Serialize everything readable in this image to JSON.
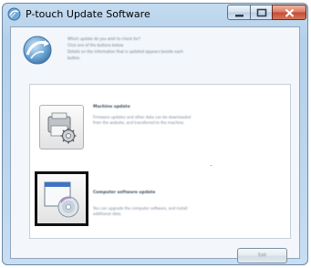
{
  "window": {
    "title": "P-touch Update Software",
    "controls": [
      "minimize",
      "maximize",
      "close"
    ]
  },
  "header": {
    "icon": "update-globe-icon",
    "lines": [
      "Which update do you wish to check for?",
      "Click one of the buttons below.",
      "Details on the information that is updated appears beside each",
      "button."
    ]
  },
  "options": [
    {
      "id": "machine",
      "icon": "printer-gear-icon",
      "title": "Machine update",
      "description_lines": [
        "Firmware updates and other data can be downloaded",
        "from the website, and transferred to the machine."
      ],
      "selected": false
    },
    {
      "id": "computer",
      "icon": "window-disc-icon",
      "title": "Computer software update",
      "description_lines": [
        "You can upgrade the computer software, and install",
        "additional data."
      ],
      "selected": true
    }
  ],
  "footer": {
    "exit_label": "Exit"
  },
  "colors": {
    "frame": "#bcd6ee",
    "client": "#f3f6fa",
    "selection_border": "#111111",
    "close_button": "#c44c32"
  }
}
